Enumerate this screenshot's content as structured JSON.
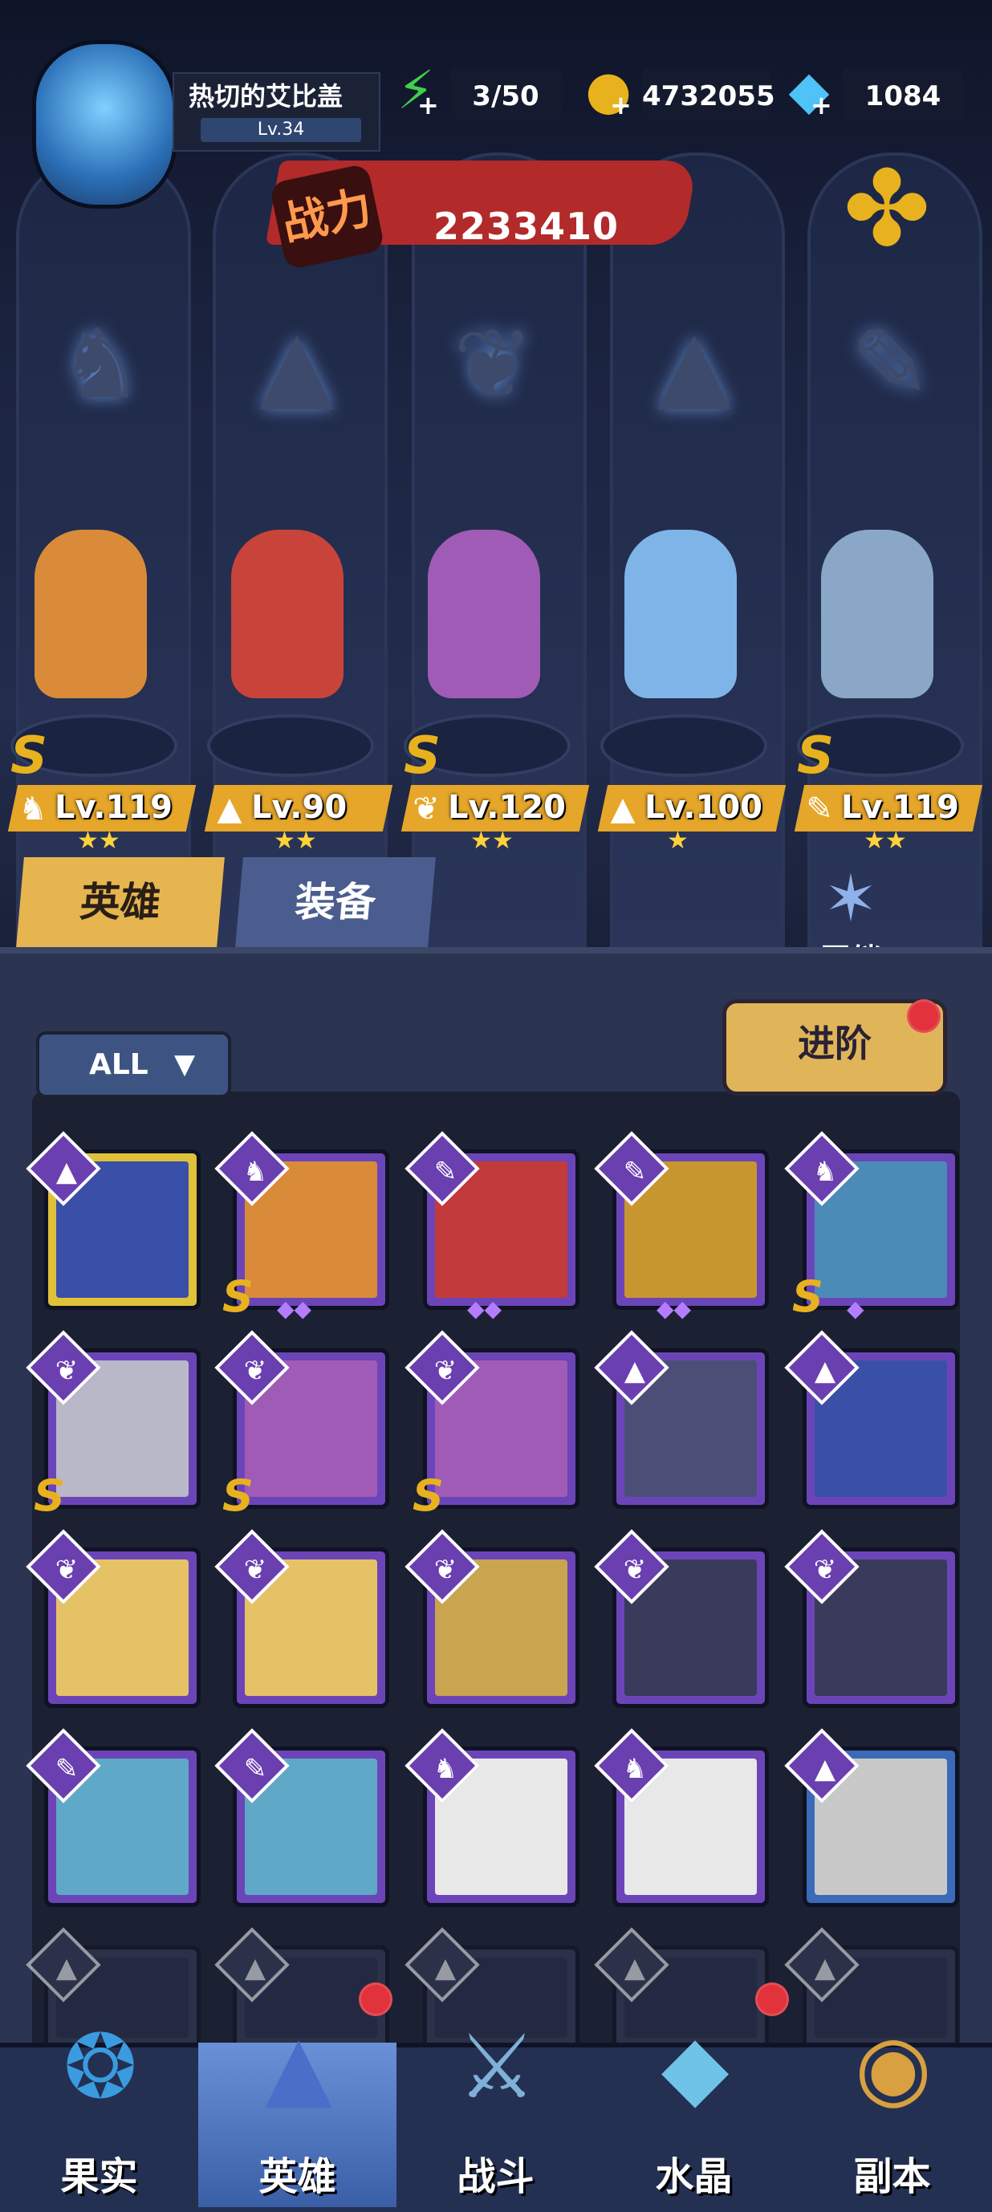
{
  "player": {
    "name": "热切的艾比盖",
    "level": "Lv.34",
    "avatar_icon": "robot-avatar-icon"
  },
  "resources": {
    "stamina": "3/50",
    "gold": "4732055",
    "diamonds": "1084"
  },
  "power": {
    "label": "战力",
    "value": "2233410"
  },
  "class_icons": [
    "beast-emblem-icon",
    "wizard-hat-icon",
    "wing-icon",
    "wizard-hat-icon",
    "wrench-icon"
  ],
  "team": [
    {
      "level": "Lv.119",
      "rank": "S",
      "stars": "★★",
      "color": "#d98b3a"
    },
    {
      "level": "Lv.90",
      "rank": "",
      "stars": "★★",
      "color": "#c8443a"
    },
    {
      "level": "Lv.120",
      "rank": "S",
      "stars": "★★",
      "color": "#a05bb7"
    },
    {
      "level": "Lv.100",
      "rank": "",
      "stars": "★",
      "color": "#7fb4e8"
    },
    {
      "level": "Lv.119",
      "rank": "S",
      "stars": "★★",
      "color": "#8aa7c7"
    }
  ],
  "tabs": {
    "heroes": "英雄",
    "equipment": "装备",
    "bond": "羁绊"
  },
  "filter": {
    "label": "ALL"
  },
  "advance_button": "进阶",
  "roster": [
    {
      "color": "#3a4fa8",
      "frame": "#e0c23a",
      "rank": "",
      "stars": ""
    },
    {
      "color": "#d98b3a",
      "frame": "#6b45b8",
      "rank": "S",
      "stars": "◆◆"
    },
    {
      "color": "#c23a3a",
      "frame": "#6b45b8",
      "rank": "",
      "stars": "◆◆"
    },
    {
      "color": "#c8962e",
      "frame": "#6b45b8",
      "rank": "",
      "stars": "◆◆"
    },
    {
      "color": "#4b8bb8",
      "frame": "#6b45b8",
      "rank": "S",
      "stars": "◆"
    },
    {
      "color": "#b8b8c8",
      "frame": "#6b45b8",
      "rank": "S",
      "stars": ""
    },
    {
      "color": "#a05bb7",
      "frame": "#6b45b8",
      "rank": "S",
      "stars": ""
    },
    {
      "color": "#a05bb7",
      "frame": "#6b45b8",
      "rank": "S",
      "stars": ""
    },
    {
      "color": "#4b4f78",
      "frame": "#6b45b8",
      "rank": "",
      "stars": ""
    },
    {
      "color": "#3a4fa8",
      "frame": "#6b45b8",
      "rank": "",
      "stars": ""
    },
    {
      "color": "#e6c266",
      "frame": "#6b45b8",
      "rank": "",
      "stars": ""
    },
    {
      "color": "#e6c266",
      "frame": "#6b45b8",
      "rank": "",
      "stars": ""
    },
    {
      "color": "#c8a54e",
      "frame": "#6b45b8",
      "rank": "",
      "stars": ""
    },
    {
      "color": "#3a3a5a",
      "frame": "#6b45b8",
      "rank": "",
      "stars": ""
    },
    {
      "color": "#3a3a5a",
      "frame": "#6b45b8",
      "rank": "",
      "stars": ""
    },
    {
      "color": "#5fa8c8",
      "frame": "#6b45b8",
      "rank": "",
      "stars": ""
    },
    {
      "color": "#5fa8c8",
      "frame": "#6b45b8",
      "rank": "",
      "stars": ""
    },
    {
      "color": "#e8e8e8",
      "frame": "#6b45b8",
      "rank": "",
      "stars": ""
    },
    {
      "color": "#e8e8e8",
      "frame": "#6b45b8",
      "rank": "",
      "stars": ""
    },
    {
      "color": "#c8c8c8",
      "frame": "#3a6ab8",
      "rank": "",
      "stars": ""
    }
  ],
  "nav": [
    {
      "label": "果实",
      "icon": "fruit-icon",
      "active": false
    },
    {
      "label": "英雄",
      "icon": "hero-wizard-icon",
      "active": true
    },
    {
      "label": "战斗",
      "icon": "battle-icon",
      "active": false
    },
    {
      "label": "水晶",
      "icon": "crystal-icon",
      "active": false
    },
    {
      "label": "副本",
      "icon": "dungeon-portal-icon",
      "active": false
    }
  ],
  "colors": {
    "gold": "#e8b21e",
    "power_red": "#b22a2a",
    "panel": "#2b3450",
    "nav_active": "#6a91d8"
  }
}
